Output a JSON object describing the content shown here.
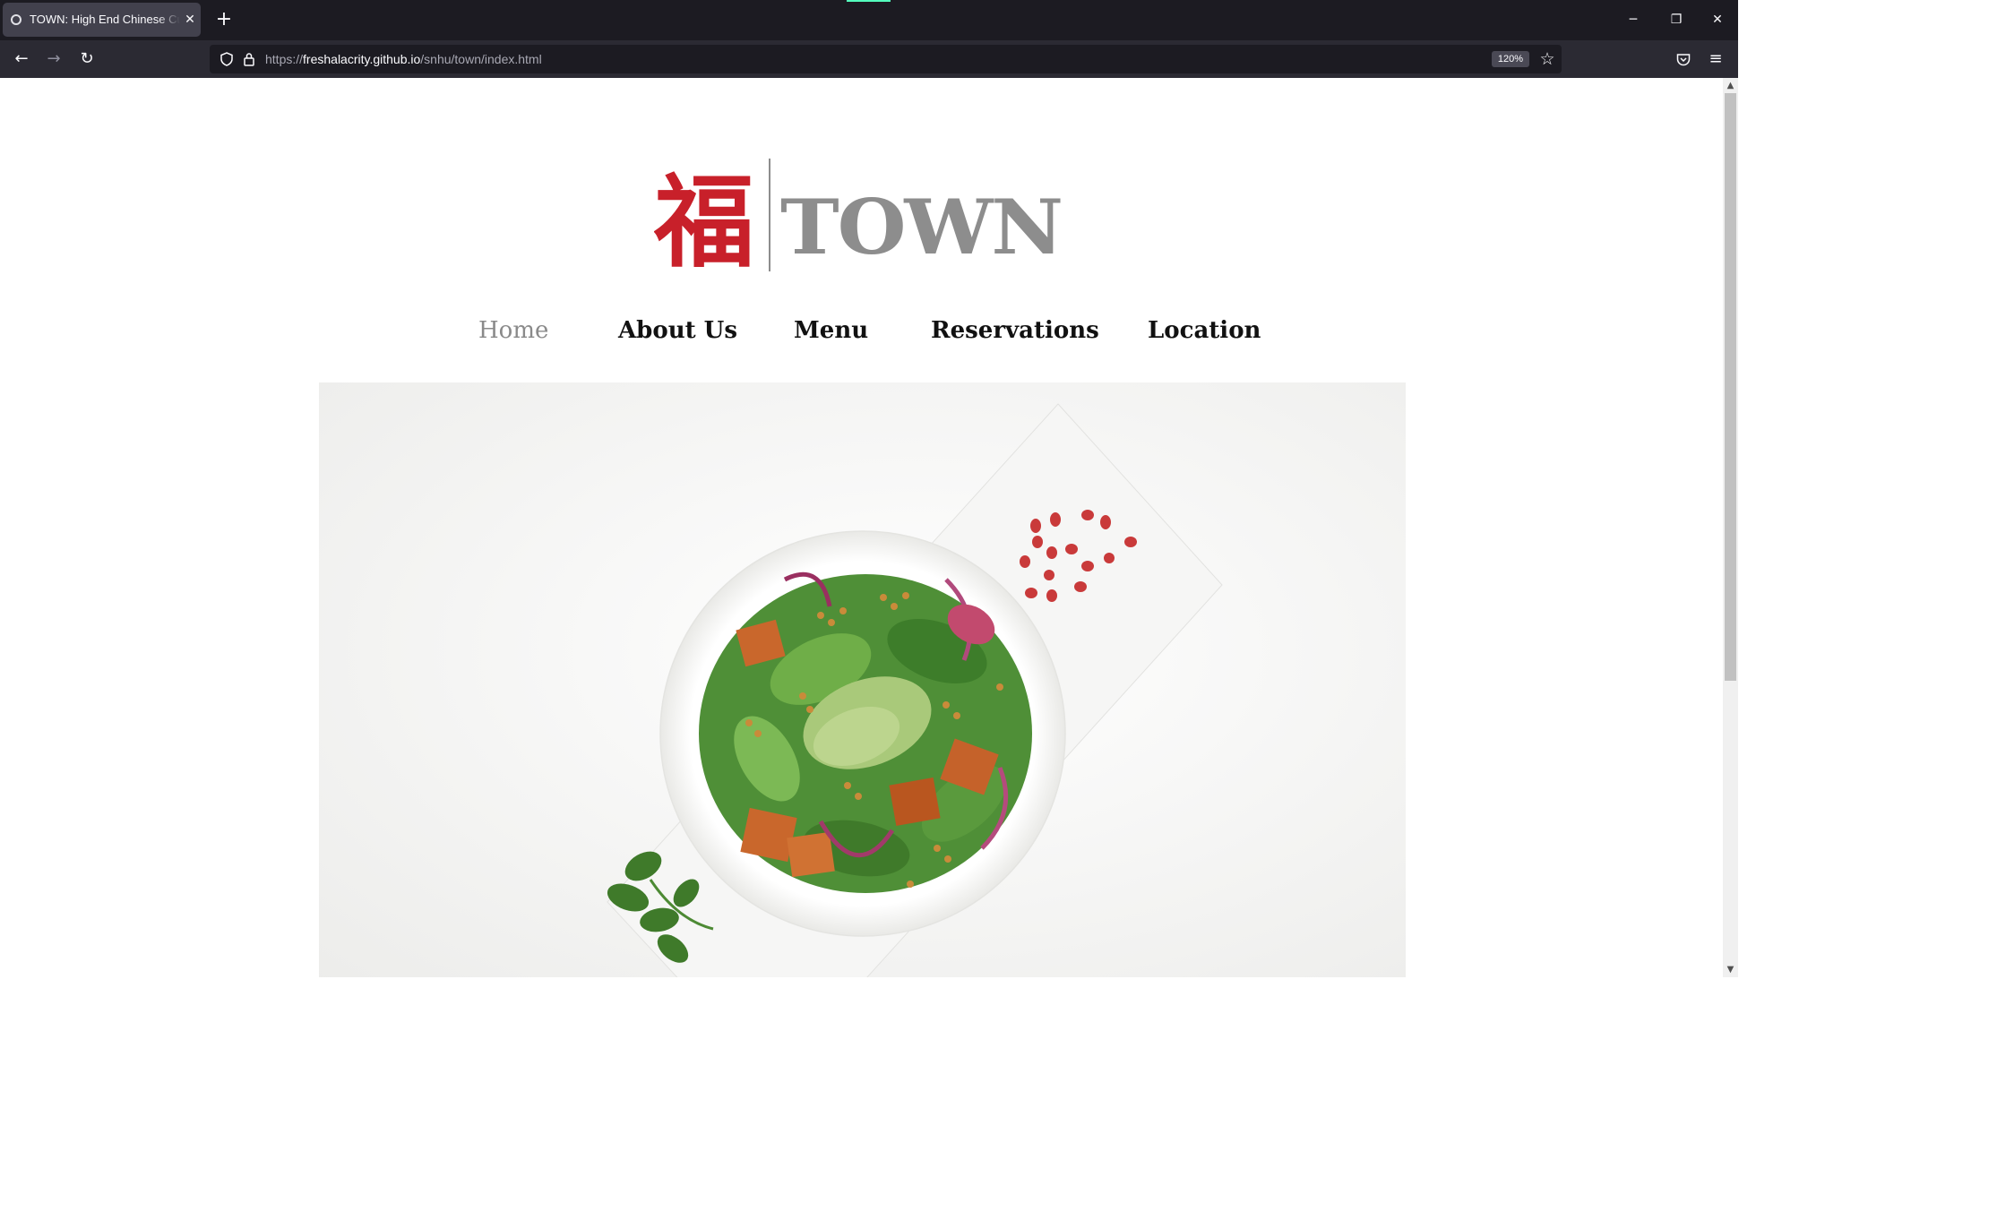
{
  "browser": {
    "tab": {
      "title": "TOWN: High End Chinese Cuisine",
      "close_glyph": "✕"
    },
    "new_tab_glyph": "+",
    "window_controls": {
      "minimize_glyph": "─",
      "restore_glyph": "❐",
      "close_glyph": "✕"
    },
    "nav": {
      "back_glyph": "←",
      "forward_glyph": "→",
      "reload_glyph": "↻"
    },
    "url": {
      "scheme": "https://",
      "host": "freshalacrity.github.io",
      "path": "/snhu/town/index.html"
    },
    "zoom": "120%",
    "icons": [
      "shield-icon",
      "lock-icon",
      "bookmark-star-icon",
      "pocket-icon",
      "menu-icon"
    ],
    "colors": {
      "tabbar": "#1c1b22",
      "toolbar": "#2b2a33",
      "active_tab": "#42414d"
    }
  },
  "site": {
    "logo": {
      "glyph": "福",
      "wordmark": "TOWN",
      "glyph_color": "#c8202a",
      "wordmark_color": "#8d8d8d"
    },
    "nav": {
      "items": [
        "Home",
        "About Us",
        "Menu",
        "Reservations",
        "Location"
      ],
      "active": "Home",
      "active_color": "#8a8a8a",
      "text_color": "#111111"
    },
    "hero": {
      "subject": "salad-bowl-image"
    }
  }
}
